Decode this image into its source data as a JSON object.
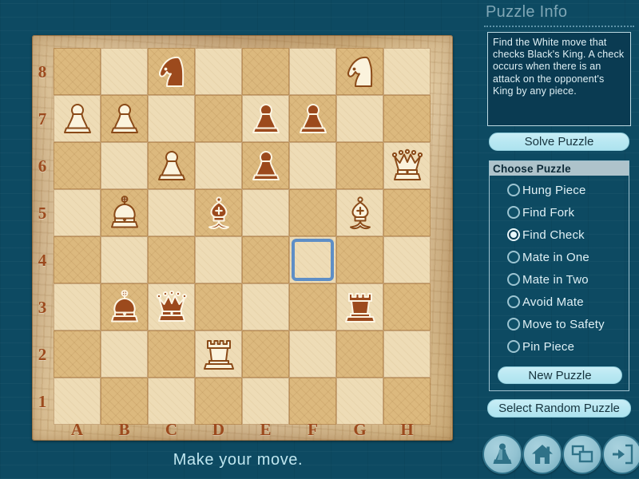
{
  "status": {
    "message": "Make your move."
  },
  "sidebar": {
    "title": "Puzzle Info",
    "info_text": "Find the White move that checks Black's King.  A check occurs when there is an attack on the opponent's King by any piece.",
    "solve_label": "Solve Puzzle",
    "choose_header": "Choose Puzzle",
    "new_puzzle_label": "New Puzzle",
    "random_label": "Select Random Puzzle",
    "options": [
      {
        "label": "Hung Piece",
        "selected": false
      },
      {
        "label": "Find Fork",
        "selected": false
      },
      {
        "label": "Find Check",
        "selected": true
      },
      {
        "label": "Mate in One",
        "selected": false
      },
      {
        "label": "Mate in Two",
        "selected": false
      },
      {
        "label": "Avoid Mate",
        "selected": false
      },
      {
        "label": "Move to Safety",
        "selected": false
      },
      {
        "label": "Pin Piece",
        "selected": false
      }
    ]
  },
  "icon_bar": {
    "buttons": [
      {
        "name": "chess-piece-icon",
        "label": ""
      },
      {
        "name": "home-icon",
        "label": ""
      },
      {
        "name": "windows-restore-icon",
        "label": ""
      },
      {
        "name": "exit-door-icon",
        "label": ""
      }
    ]
  },
  "board": {
    "files": [
      "A",
      "B",
      "C",
      "D",
      "E",
      "F",
      "G",
      "H"
    ],
    "ranks": [
      "8",
      "7",
      "6",
      "5",
      "4",
      "3",
      "2",
      "1"
    ],
    "selected_square": "F4",
    "pieces": [
      {
        "square": "C8",
        "piece": "knight",
        "color": "black"
      },
      {
        "square": "G8",
        "piece": "knight",
        "color": "white"
      },
      {
        "square": "A7",
        "piece": "pawn",
        "color": "white"
      },
      {
        "square": "B7",
        "piece": "pawn",
        "color": "white"
      },
      {
        "square": "E7",
        "piece": "pawn",
        "color": "black"
      },
      {
        "square": "F7",
        "piece": "pawn",
        "color": "black"
      },
      {
        "square": "C6",
        "piece": "pawn",
        "color": "white"
      },
      {
        "square": "E6",
        "piece": "pawn",
        "color": "black"
      },
      {
        "square": "H6",
        "piece": "queen",
        "color": "white"
      },
      {
        "square": "B5",
        "piece": "king",
        "color": "white"
      },
      {
        "square": "D5",
        "piece": "bishop",
        "color": "black"
      },
      {
        "square": "G5",
        "piece": "bishop",
        "color": "white"
      },
      {
        "square": "B3",
        "piece": "king",
        "color": "black"
      },
      {
        "square": "C3",
        "piece": "queen",
        "color": "black"
      },
      {
        "square": "G3",
        "piece": "rook",
        "color": "black"
      },
      {
        "square": "D2",
        "piece": "rook",
        "color": "white"
      }
    ]
  },
  "colors": {
    "background": "#0d4a62",
    "light_square": "#eedcb6",
    "dark_square": "#dcb97e",
    "selection": "#5e8ec6",
    "button": "#b9e8f2",
    "white_piece": "#fbf3dd",
    "black_piece": "#9c4a1d",
    "piece_outline": "#8a4a18"
  }
}
